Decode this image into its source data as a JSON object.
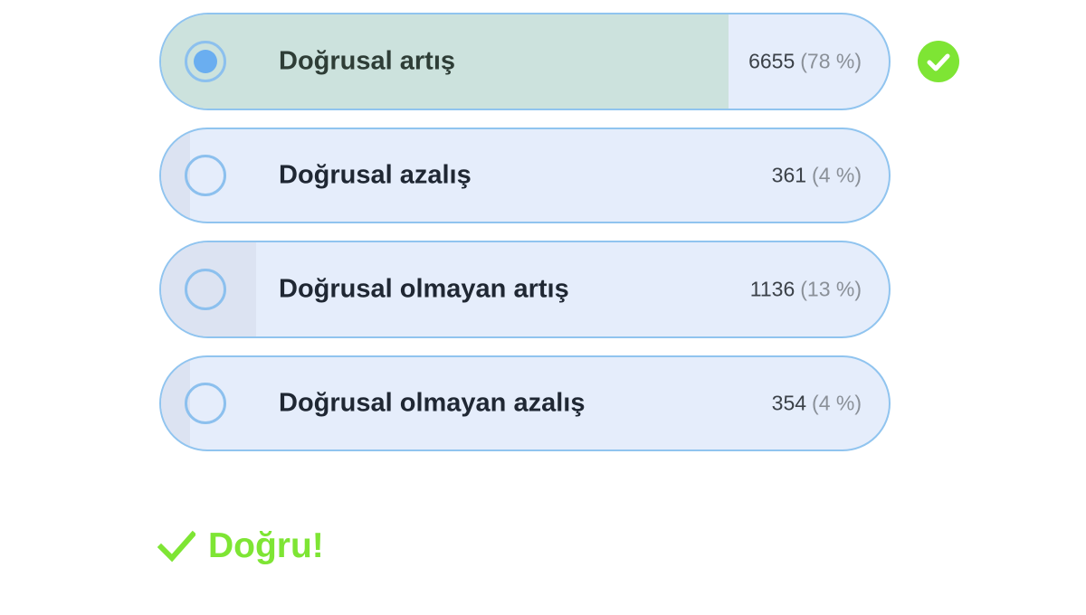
{
  "options": [
    {
      "label": "Doğrusal artış",
      "count": "6655",
      "percent": "(78 %)",
      "share": 0.78,
      "selected": true,
      "correct": true
    },
    {
      "label": "Doğrusal azalış",
      "count": "361",
      "percent": "(4 %)",
      "share": 0.04,
      "selected": false,
      "correct": false
    },
    {
      "label": "Doğrusal olmayan artış",
      "count": "1136",
      "percent": "(13 %)",
      "share": 0.13,
      "selected": false,
      "correct": false
    },
    {
      "label": "Doğrusal olmayan azalış",
      "count": "354",
      "percent": "(4 %)",
      "share": 0.04,
      "selected": false,
      "correct": false
    }
  ],
  "result": {
    "text": "Doğru!",
    "icon": "checkmark-icon",
    "color": "#7ee534"
  },
  "correct_badge": {
    "icon": "check-circle-icon",
    "color": "#7ee534"
  },
  "colors": {
    "option_border": "#90c4ef",
    "option_background": "#e5edfb",
    "correct_fill": "#cce2dd",
    "vote_fill": "#dce3f2",
    "radio": "#8cc0ee"
  }
}
